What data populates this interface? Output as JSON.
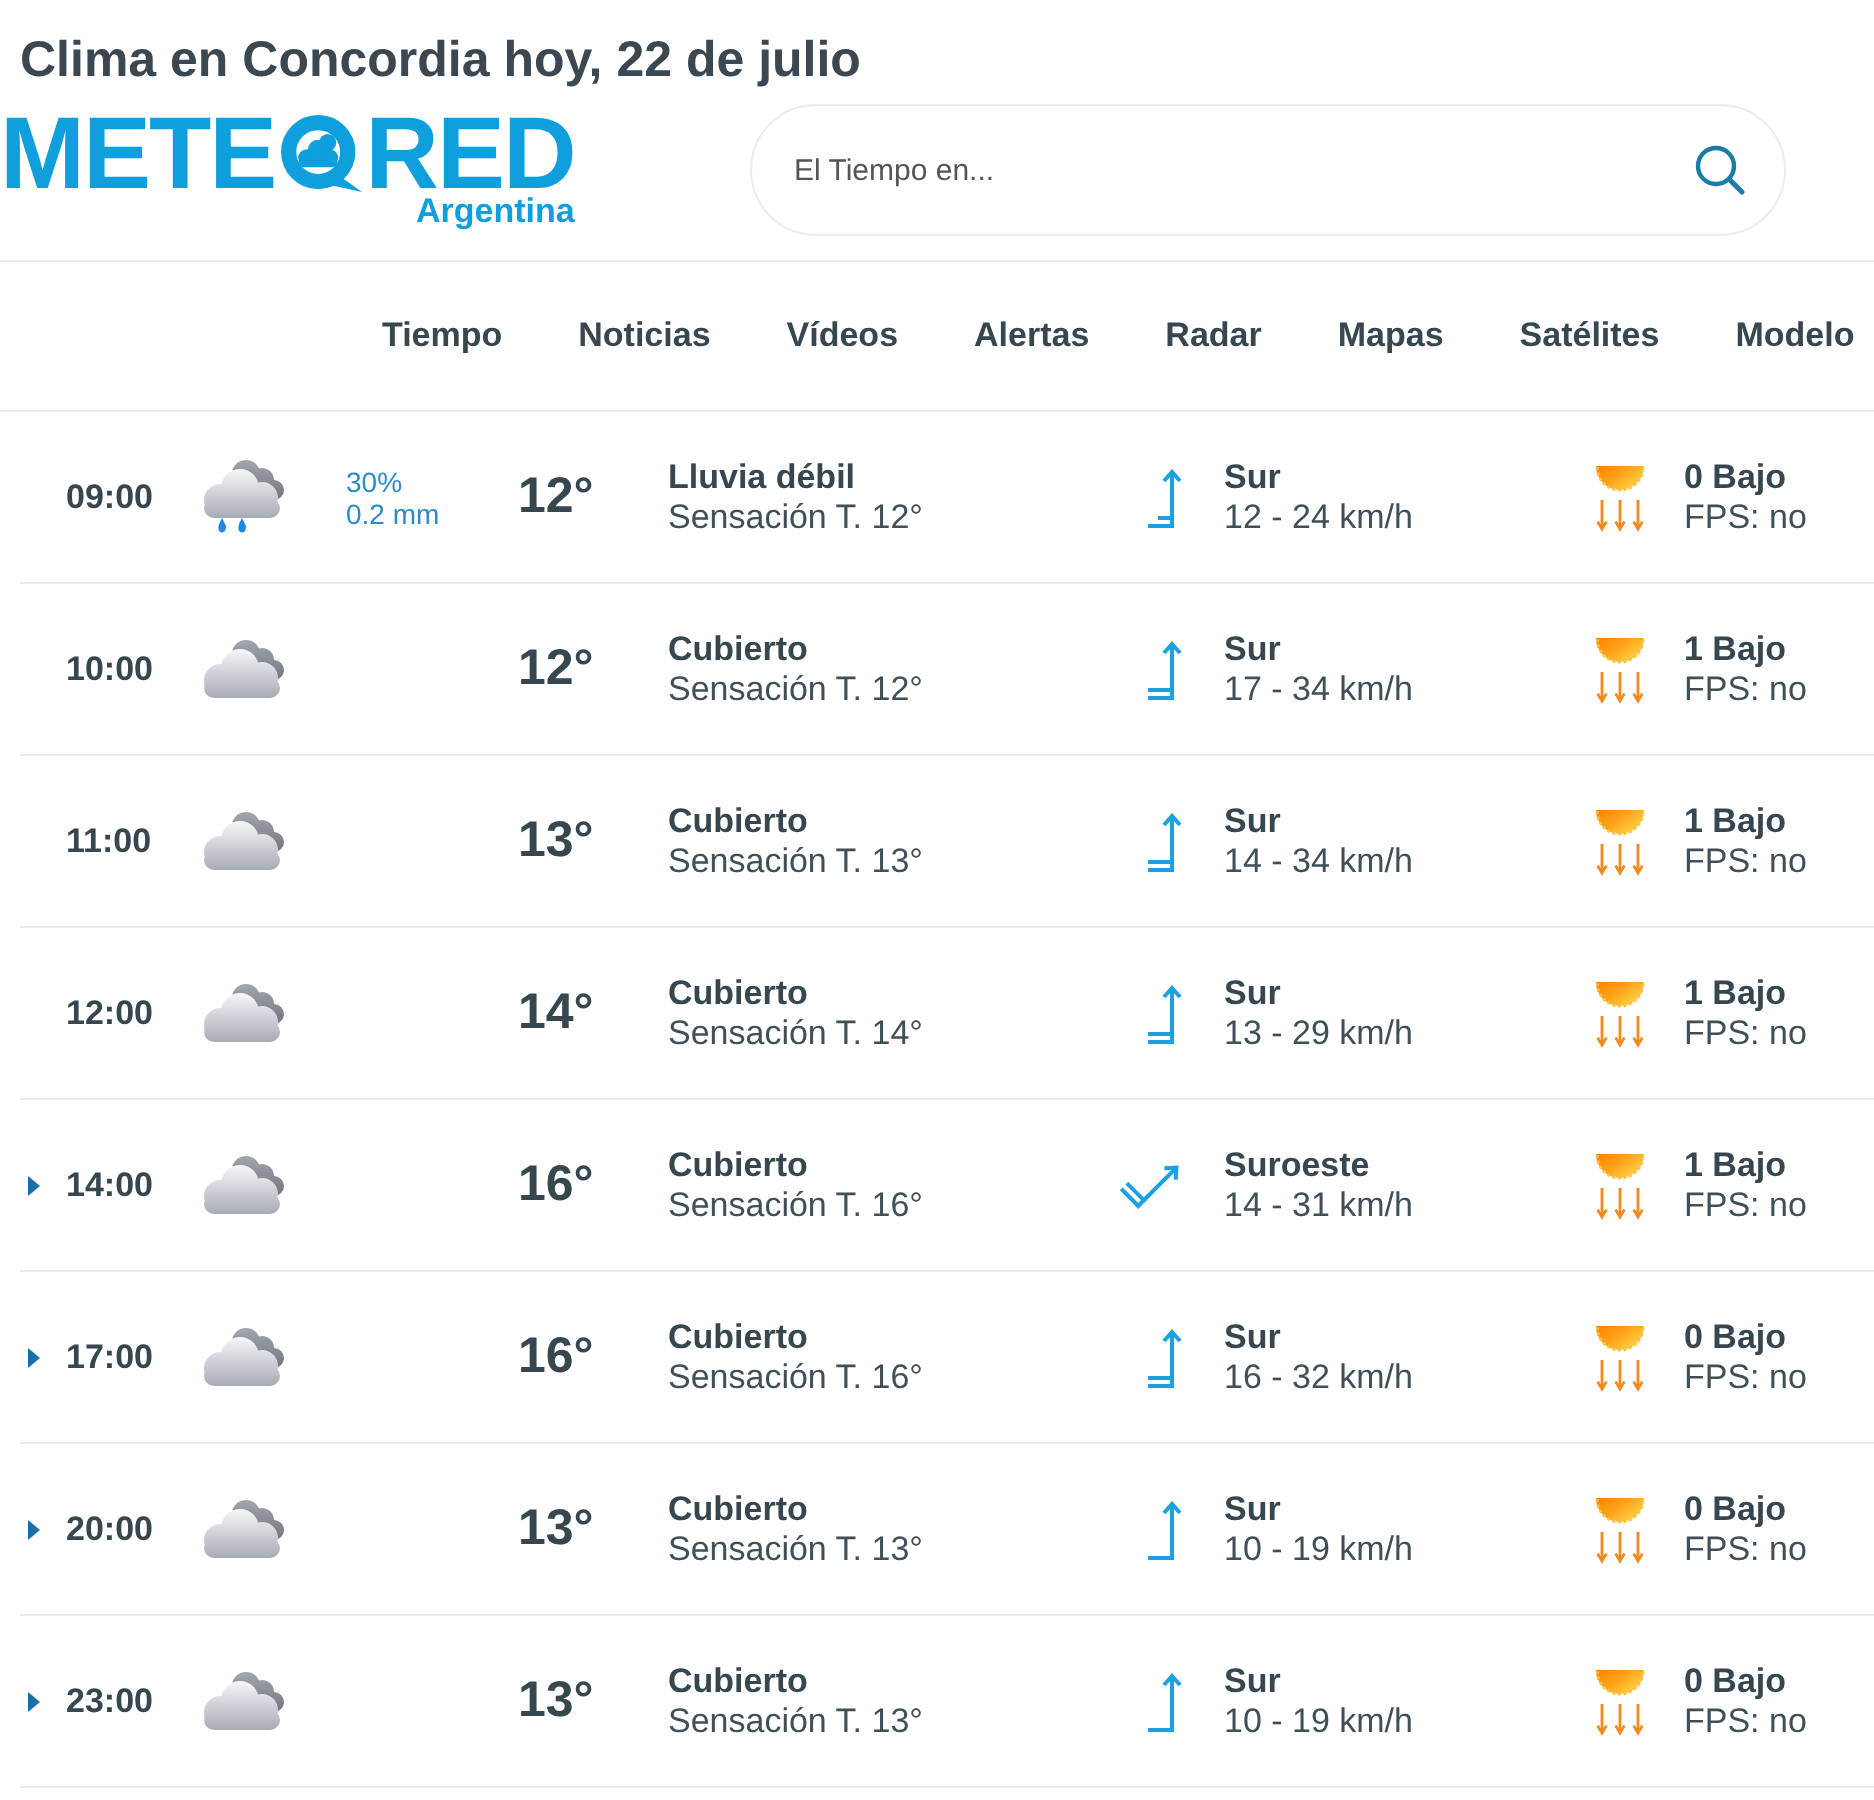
{
  "page_title": "Clima en Concordia hoy, 22 de julio",
  "logo": {
    "wordmark_start": "METE",
    "wordmark_end": "RED",
    "region": "Argentina"
  },
  "search": {
    "placeholder": "El Tiempo en..."
  },
  "nav": [
    "Tiempo",
    "Noticias",
    "Vídeos",
    "Alertas",
    "Radar",
    "Mapas",
    "Satélites",
    "Modelo"
  ],
  "hours": [
    {
      "time": "09:00",
      "expandable": false,
      "sky": {
        "kind": "rain"
      },
      "precip": {
        "chance": "30%",
        "amount": "0.2 mm"
      },
      "temp": "12°",
      "condition": "Lluvia débil",
      "feels_like": "Sensación T. 12°",
      "wind": {
        "direction": "Sur",
        "speed": "12 - 24 km/h",
        "arrow": {
          "kind": "up-halfbarb"
        }
      },
      "uv": {
        "index": "0 Bajo",
        "spf": "FPS: no"
      }
    },
    {
      "time": "10:00",
      "expandable": false,
      "sky": {
        "kind": "overcast"
      },
      "temp": "12°",
      "condition": "Cubierto",
      "feels_like": "Sensación T. 12°",
      "wind": {
        "direction": "Sur",
        "speed": "17 - 34 km/h",
        "arrow": {
          "kind": "up-double"
        }
      },
      "uv": {
        "index": "1 Bajo",
        "spf": "FPS: no"
      }
    },
    {
      "time": "11:00",
      "expandable": false,
      "sky": {
        "kind": "overcast"
      },
      "temp": "13°",
      "condition": "Cubierto",
      "feels_like": "Sensación T. 13°",
      "wind": {
        "direction": "Sur",
        "speed": "14 - 34 km/h",
        "arrow": {
          "kind": "up-double"
        }
      },
      "uv": {
        "index": "1 Bajo",
        "spf": "FPS: no"
      }
    },
    {
      "time": "12:00",
      "expandable": false,
      "sky": {
        "kind": "overcast"
      },
      "temp": "14°",
      "condition": "Cubierto",
      "feels_like": "Sensación T. 14°",
      "wind": {
        "direction": "Sur",
        "speed": "13 - 29 km/h",
        "arrow": {
          "kind": "up-double"
        }
      },
      "uv": {
        "index": "1 Bajo",
        "spf": "FPS: no"
      }
    },
    {
      "time": "14:00",
      "expandable": true,
      "sky": {
        "kind": "overcast"
      },
      "temp": "16°",
      "condition": "Cubierto",
      "feels_like": "Sensación T. 16°",
      "wind": {
        "direction": "Suroeste",
        "speed": "14 - 31 km/h",
        "arrow": {
          "kind": "upright-double"
        }
      },
      "uv": {
        "index": "1 Bajo",
        "spf": "FPS: no"
      }
    },
    {
      "time": "17:00",
      "expandable": true,
      "sky": {
        "kind": "overcast"
      },
      "temp": "16°",
      "condition": "Cubierto",
      "feels_like": "Sensación T. 16°",
      "wind": {
        "direction": "Sur",
        "speed": "16 - 32 km/h",
        "arrow": {
          "kind": "up-double"
        }
      },
      "uv": {
        "index": "0 Bajo",
        "spf": "FPS: no"
      }
    },
    {
      "time": "20:00",
      "expandable": true,
      "sky": {
        "kind": "overcast"
      },
      "temp": "13°",
      "condition": "Cubierto",
      "feels_like": "Sensación T. 13°",
      "wind": {
        "direction": "Sur",
        "speed": "10 - 19 km/h",
        "arrow": {
          "kind": "up-single"
        }
      },
      "uv": {
        "index": "0 Bajo",
        "spf": "FPS: no"
      }
    },
    {
      "time": "23:00",
      "expandable": true,
      "sky": {
        "kind": "overcast"
      },
      "temp": "13°",
      "condition": "Cubierto",
      "feels_like": "Sensación T. 13°",
      "wind": {
        "direction": "Sur",
        "speed": "10 - 19 km/h",
        "arrow": {
          "kind": "up-single"
        }
      },
      "uv": {
        "index": "0 Bajo",
        "spf": "FPS: no"
      }
    }
  ]
}
